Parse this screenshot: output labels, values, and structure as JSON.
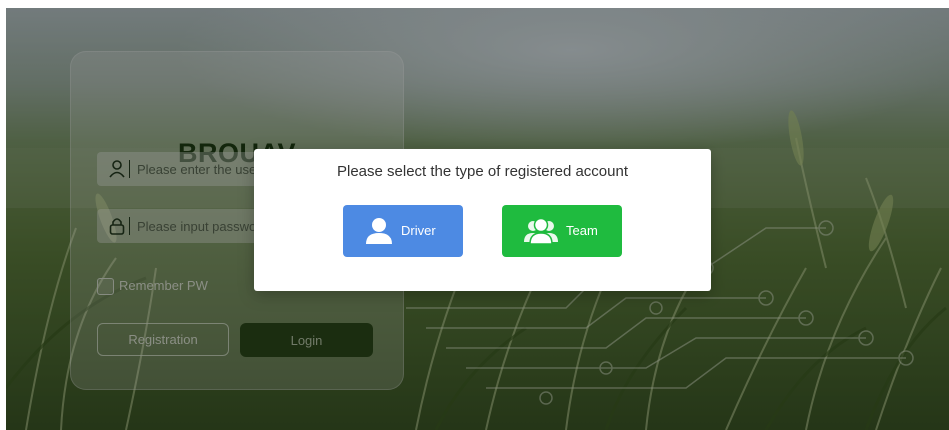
{
  "login": {
    "brand": "BROUAV",
    "username_placeholder": "Please enter the user name",
    "password_placeholder": "Please input password",
    "remember_label": "Remember PW",
    "register_label": "Registration",
    "login_label": "Login",
    "user_icon": "user-icon",
    "lock_icon": "lock-icon"
  },
  "modal": {
    "title": "Please select the type of registered account",
    "options": [
      {
        "label": "Driver",
        "icon": "person-icon",
        "color": "#4d8ae3"
      },
      {
        "label": "Team",
        "icon": "group-icon",
        "color": "#1fbb3f"
      }
    ]
  },
  "colors": {
    "brand": "#203e14",
    "login_button": "#2d4a1a",
    "backdrop": "rgba(0,0,0,0.38)"
  }
}
